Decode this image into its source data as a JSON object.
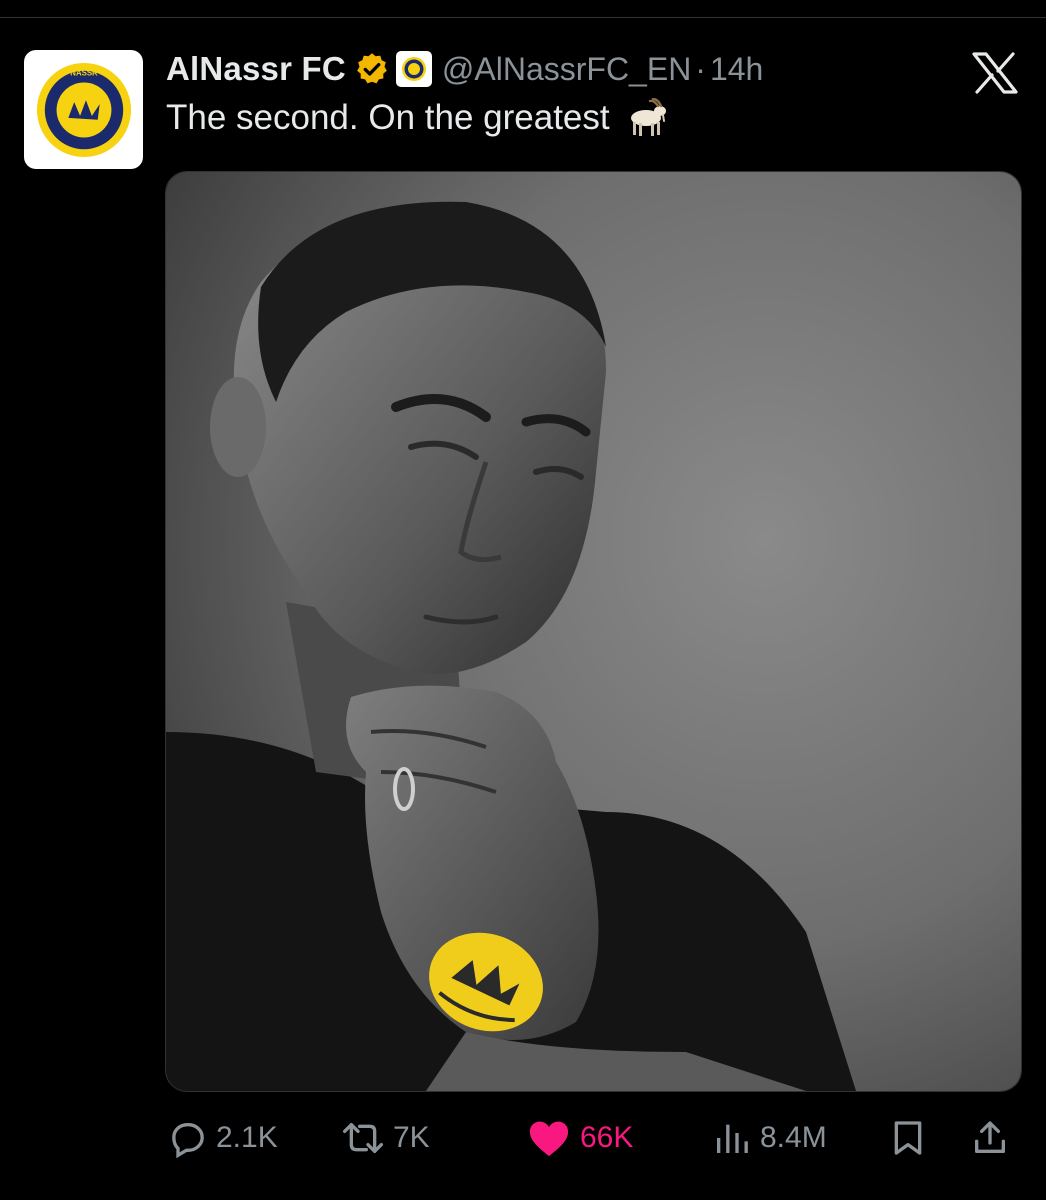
{
  "tweet": {
    "author": {
      "display_name": "AlNassr FC",
      "handle": "@AlNassrFC_EN",
      "avatar_icon": "al-nassr-crest-icon",
      "verified": true,
      "verified_badge_color": "#f4b700"
    },
    "separator": "·",
    "timestamp": "14h",
    "text": "The second. On the greatest",
    "emoji": "goat-emoji",
    "media": {
      "kind": "photo",
      "description_icon": "photo-portrait-icon"
    }
  },
  "actions": {
    "replies": "2.1K",
    "reposts": "7K",
    "likes": "66K",
    "views": "8.4M",
    "liked": true
  },
  "colors": {
    "background": "#000000",
    "text_primary": "#e7e9ea",
    "text_secondary": "#8b9298",
    "like_active": "#f91880",
    "brand_yellow": "#f7d210",
    "brand_navy": "#1a2a6c"
  }
}
